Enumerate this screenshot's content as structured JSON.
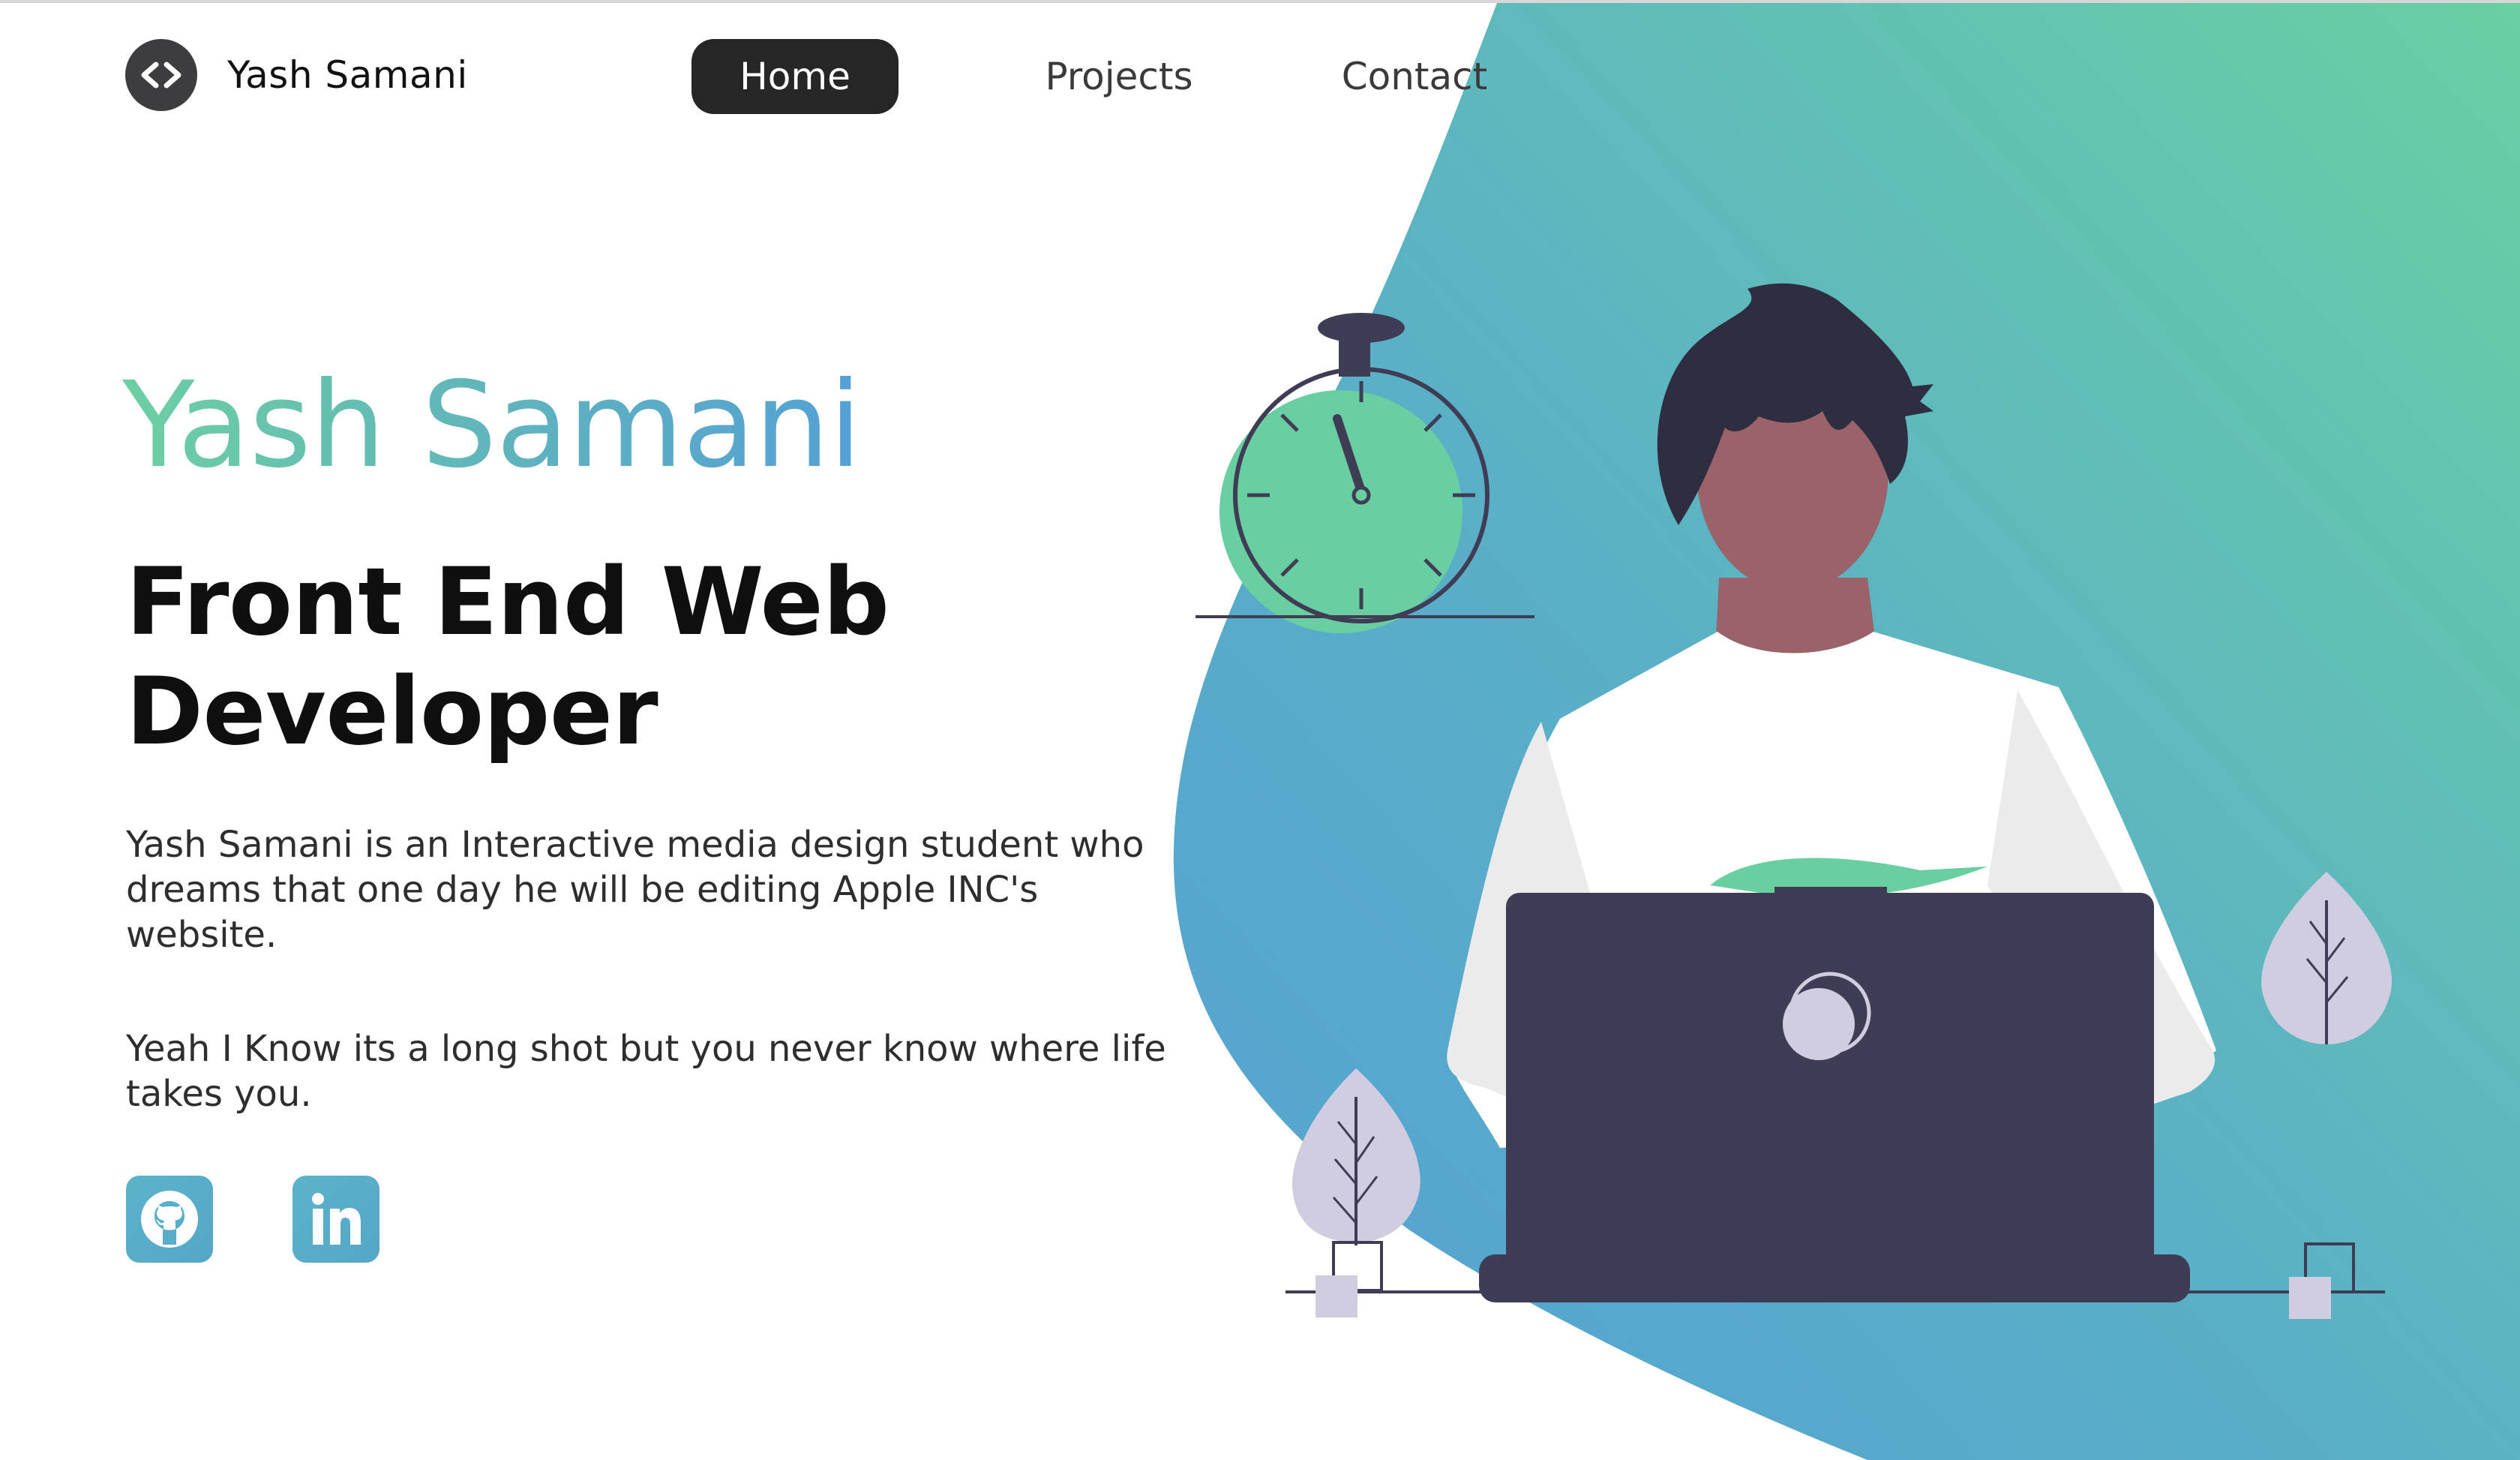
{
  "brand": {
    "logo_icon": "code-brackets-icon",
    "name": "Yash Samani"
  },
  "nav": {
    "items": [
      {
        "label": "Home",
        "active": true
      },
      {
        "label": "Projects",
        "active": false
      },
      {
        "label": "Contact",
        "active": false
      }
    ]
  },
  "hero": {
    "title": "Yash Samani",
    "role_line_1": "Front End Web",
    "role_line_2": "Developer",
    "paragraph_1": "Yash Samani is an Interactive media design student who dreams that one day he will be editing Apple INC's website.",
    "paragraph_2": "Yeah I Know its a long shot but you never know where life takes you.",
    "illustration": "person-with-laptop-and-stopwatch"
  },
  "social": [
    {
      "icon": "github-icon",
      "name": "GitHub"
    },
    {
      "icon": "linkedin-icon",
      "name": "LinkedIn"
    }
  ],
  "colors": {
    "accent_green": "#6dcfa2",
    "accent_blue": "#55a0d6",
    "nav_active_bg": "#262626",
    "laptop": "#3f3d56",
    "leaf": "#d0cde1",
    "skin": "#9a636a",
    "hair": "#2f2e41"
  }
}
